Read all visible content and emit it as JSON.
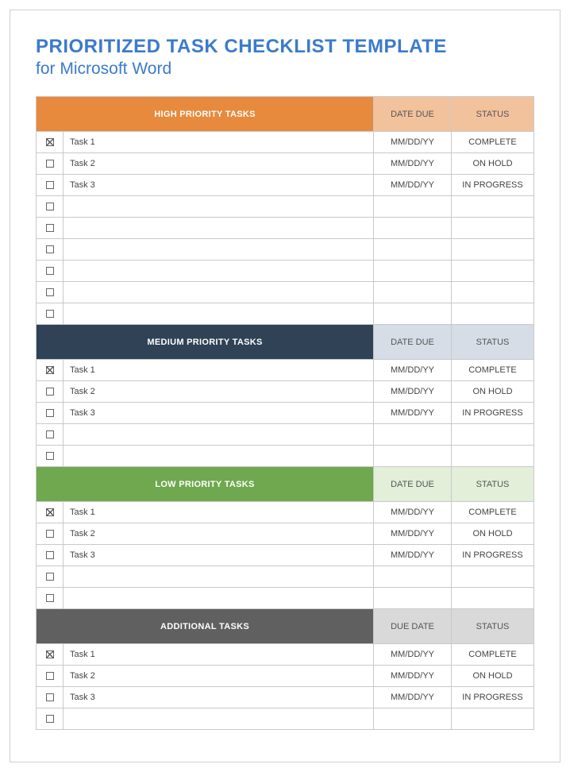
{
  "title": "PRIORITIZED TASK CHECKLIST TEMPLATE",
  "subtitle": "for Microsoft Word",
  "colors": {
    "title": "#3b7bcc",
    "high_header": "#e78a3d",
    "high_header_light": "#f2c29d",
    "medium_header": "#2f4256",
    "medium_header_light": "#d6dde6",
    "low_header": "#6fa84f",
    "low_header_light": "#e3efd9",
    "additional_header": "#606060",
    "additional_header_light": "#d9d9d9"
  },
  "sections": [
    {
      "id": "high",
      "header_tasks": "HIGH PRIORITY TASKS",
      "header_date": "DATE DUE",
      "header_status": "STATUS",
      "header_class": "hdr-high",
      "header_lite_class": "hdr-high-lite",
      "rows": [
        {
          "checked": true,
          "task": "Task 1",
          "date": "MM/DD/YY",
          "status": "COMPLETE"
        },
        {
          "checked": false,
          "task": "Task 2",
          "date": "MM/DD/YY",
          "status": "ON HOLD"
        },
        {
          "checked": false,
          "task": "Task 3",
          "date": "MM/DD/YY",
          "status": "IN PROGRESS"
        },
        {
          "checked": false,
          "task": "",
          "date": "",
          "status": ""
        },
        {
          "checked": false,
          "task": "",
          "date": "",
          "status": ""
        },
        {
          "checked": false,
          "task": "",
          "date": "",
          "status": ""
        },
        {
          "checked": false,
          "task": "",
          "date": "",
          "status": ""
        },
        {
          "checked": false,
          "task": "",
          "date": "",
          "status": ""
        },
        {
          "checked": false,
          "task": "",
          "date": "",
          "status": ""
        }
      ]
    },
    {
      "id": "medium",
      "header_tasks": "MEDIUM PRIORITY TASKS",
      "header_date": "DATE DUE",
      "header_status": "STATUS",
      "header_class": "hdr-med",
      "header_lite_class": "hdr-med-lite",
      "rows": [
        {
          "checked": true,
          "task": "Task 1",
          "date": "MM/DD/YY",
          "status": "COMPLETE"
        },
        {
          "checked": false,
          "task": "Task 2",
          "date": "MM/DD/YY",
          "status": "ON HOLD"
        },
        {
          "checked": false,
          "task": "Task 3",
          "date": "MM/DD/YY",
          "status": "IN PROGRESS"
        },
        {
          "checked": false,
          "task": "",
          "date": "",
          "status": ""
        },
        {
          "checked": false,
          "task": "",
          "date": "",
          "status": ""
        }
      ]
    },
    {
      "id": "low",
      "header_tasks": "LOW PRIORITY TASKS",
      "header_date": "DATE DUE",
      "header_status": "STATUS",
      "header_class": "hdr-low",
      "header_lite_class": "hdr-low-lite",
      "rows": [
        {
          "checked": true,
          "task": "Task 1",
          "date": "MM/DD/YY",
          "status": "COMPLETE"
        },
        {
          "checked": false,
          "task": "Task 2",
          "date": "MM/DD/YY",
          "status": "ON HOLD"
        },
        {
          "checked": false,
          "task": "Task 3",
          "date": "MM/DD/YY",
          "status": "IN PROGRESS"
        },
        {
          "checked": false,
          "task": "",
          "date": "",
          "status": ""
        },
        {
          "checked": false,
          "task": "",
          "date": "",
          "status": ""
        }
      ]
    },
    {
      "id": "additional",
      "header_tasks": "ADDITIONAL TASKS",
      "header_date": "DUE DATE",
      "header_status": "STATUS",
      "header_class": "hdr-add",
      "header_lite_class": "hdr-add-lite",
      "rows": [
        {
          "checked": true,
          "task": "Task 1",
          "date": "MM/DD/YY",
          "status": "COMPLETE"
        },
        {
          "checked": false,
          "task": "Task 2",
          "date": "MM/DD/YY",
          "status": "ON HOLD"
        },
        {
          "checked": false,
          "task": "Task 3",
          "date": "MM/DD/YY",
          "status": "IN PROGRESS"
        },
        {
          "checked": false,
          "task": "",
          "date": "",
          "status": ""
        }
      ]
    }
  ]
}
